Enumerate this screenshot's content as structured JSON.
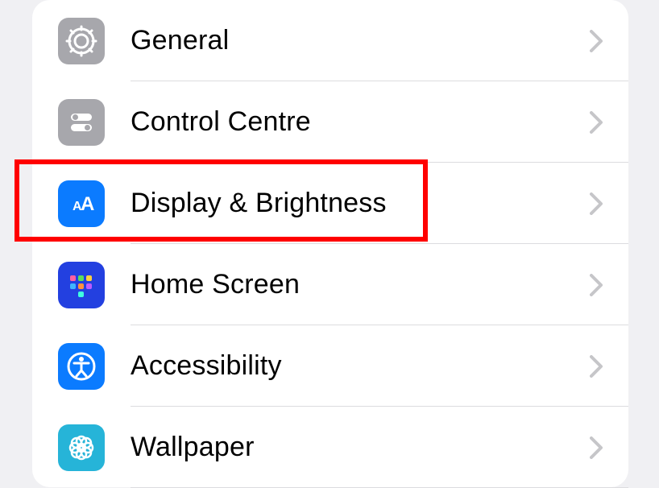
{
  "settings": {
    "items": [
      {
        "label": "General"
      },
      {
        "label": "Control Centre"
      },
      {
        "label": "Display & Brightness"
      },
      {
        "label": "Home Screen"
      },
      {
        "label": "Accessibility"
      },
      {
        "label": "Wallpaper"
      }
    ],
    "highlighted_index": 2
  }
}
